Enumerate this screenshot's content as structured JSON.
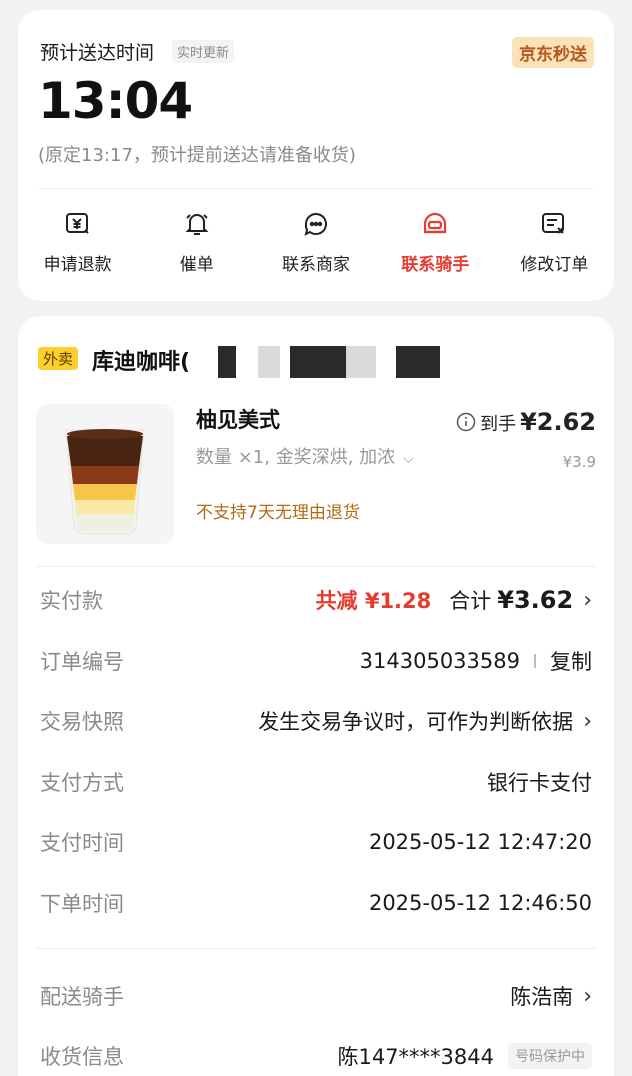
{
  "delivery": {
    "eta_label": "预计送达时间",
    "live_badge": "实时更新",
    "service_badge": "京东秒送",
    "eta_time": "13:04",
    "eta_note": "(原定13:17，预计提前送达请准备收货)"
  },
  "actions": [
    {
      "label": "申请退款",
      "icon": "refund-icon"
    },
    {
      "label": "催单",
      "icon": "bell-icon"
    },
    {
      "label": "联系商家",
      "icon": "merchant-chat-icon"
    },
    {
      "label": "联系骑手",
      "icon": "rider-helmet-icon",
      "active": true
    },
    {
      "label": "修改订单",
      "icon": "edit-order-icon"
    }
  ],
  "order": {
    "type_tag": "外卖",
    "shop_name": "库迪咖啡(",
    "item": {
      "name": "柚见美式",
      "spec": "数量 ×1, 金奖深烘, 加浓",
      "policy": "不支持7天无理由退货",
      "net_label": "到手",
      "net_price": "¥2.62",
      "orig_price": "¥3.9"
    },
    "paid": {
      "label": "实付款",
      "discount": "共减 ¥1.28",
      "total_label": "合计",
      "total_value": "¥3.62"
    },
    "order_no": {
      "label": "订单编号",
      "value": "314305033589",
      "copy": "复制"
    },
    "snapshot": {
      "label": "交易快照",
      "value": "发生交易争议时，可作为判断依据"
    },
    "pay_method": {
      "label": "支付方式",
      "value": "银行卡支付"
    },
    "pay_time": {
      "label": "支付时间",
      "value": "2025-05-12 12:47:20"
    },
    "order_time": {
      "label": "下单时间",
      "value": "2025-05-12 12:46:50"
    },
    "rider": {
      "label": "配送骑手",
      "value": "陈浩南"
    },
    "receiver": {
      "label": "收货信息",
      "value": "陈147****3844",
      "badge": "号码保护中"
    }
  },
  "colors": {
    "accent_red": "#e63c2f",
    "badge_bg": "#fbe3b9",
    "tag_yellow": "#ffcf2e",
    "page_bg": "#f2f2f2"
  }
}
